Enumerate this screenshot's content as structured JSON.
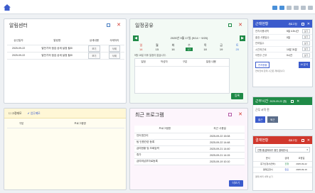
{
  "notice": {
    "title": "알림센터",
    "columns": [
      "송신일자",
      "알림명",
      "상세내용",
      "삭제처리"
    ],
    "rows": [
      {
        "date": "2025-09-22",
        "name": "발전기의 점검 상세 설정 필요",
        "detail": "보기",
        "delete": "삭제"
      },
      {
        "date": "2025-09-22",
        "name": "발전기의 점검 상세 설정 필요",
        "detail": "보기",
        "delete": "삭제"
      }
    ]
  },
  "schedule": {
    "title": "일정공유",
    "month_label": "2025년 9월 17일 (9/14 ~ 9/20)",
    "weekdays": [
      "일",
      "월",
      "화",
      "수",
      "목",
      "금",
      "토"
    ],
    "dates": [
      "14",
      "15",
      "16",
      "17",
      "18",
      "19",
      "20"
    ],
    "note": "9월 18일 이후 일정이 없습니다.",
    "columns": [
      "일정",
      "작성자",
      "구분",
      "일정 내용"
    ],
    "register_btn": "등록"
  },
  "memo": {
    "chk1": "고정메모",
    "chk2": "업무메모",
    "columns": [
      "구분",
      "프로그램명"
    ]
  },
  "recent": {
    "title": "최근 프로그램",
    "columns": [
      "프로그램명",
      "최근 사용일"
    ],
    "rows": [
      {
        "name": "인터넷관리",
        "date": "2025-09-22 15:08"
      },
      {
        "name": "팀 인원관련 등록",
        "date": "2025-09-22 14:48"
      },
      {
        "name": "급여현황 및 조회입력",
        "date": "2025-09-21 14:40"
      },
      {
        "name": "휴가",
        "date": "2025-09-21 14:15"
      },
      {
        "name": "급여외납부자료등록",
        "date": "2025-09-19 10:10"
      }
    ],
    "more_btn": "더보기"
  },
  "attendance": {
    "title": "근태현황",
    "sub": "새로고침",
    "rows": [
      {
        "k": "연차사용내역",
        "v": "5일 4.5시간",
        "b": "보기"
      },
      {
        "k": "출장 사용일수",
        "v": "0일",
        "b": "보기"
      },
      {
        "k": "잔여일수",
        "v": "",
        "b": "보기"
      },
      {
        "k": "시간외근로",
        "v": "10분 31분",
        "b": "보기"
      },
      {
        "k": "이번주 근무",
        "v": "0시간",
        "b": "보기"
      }
    ],
    "tab1": "연차현황",
    "tab2": "AI 분석",
    "foot": "연차잔여 합계 시간은 제외됩니다."
  },
  "work": {
    "title": "근무시간",
    "sub": "2025-09-22 (월)",
    "label": "근무 시작 전",
    "btn1": "출근",
    "btn2": "퇴근"
  },
  "approval": {
    "title": "결재현황",
    "sub": "새로고침",
    "filter": "진행 중(결재대기 중인 결재문서)",
    "columns": [
      "문서",
      "상태",
      "요청일"
    ],
    "rows": [
      {
        "doc": "휴가신청서(연차)",
        "status": "진행",
        "date": "2025-09-22"
      },
      {
        "doc": "결재요청서",
        "status": "완료",
        "date": "2025-09-19"
      }
    ],
    "foot": "결재 처리 내역 보기"
  }
}
